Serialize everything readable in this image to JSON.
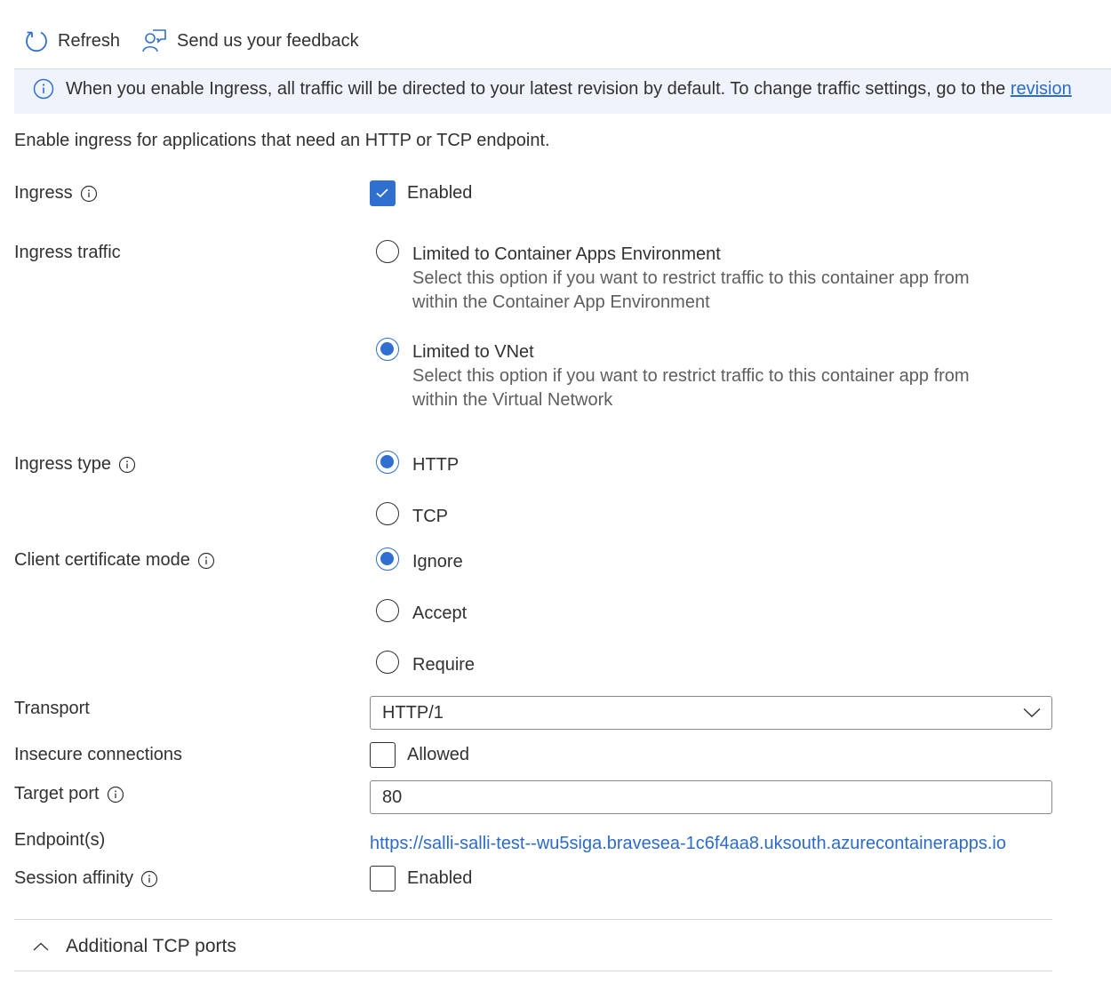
{
  "toolbar": {
    "refresh_label": "Refresh",
    "feedback_label": "Send us your feedback"
  },
  "banner": {
    "text": "When you enable Ingress, all traffic will be directed to your latest revision by default. To change traffic settings, go to the ",
    "link_text": "revision"
  },
  "intro": "Enable ingress for applications that need an HTTP or TCP endpoint.",
  "colors": {
    "accent": "#2f6fd0",
    "link": "#2c6bc9",
    "banner_bg": "#eff4fc"
  },
  "form": {
    "ingress": {
      "label": "Ingress",
      "checkbox_label": "Enabled",
      "checked": true
    },
    "ingress_traffic": {
      "label": "Ingress traffic",
      "options": [
        {
          "label": "Limited to Container Apps Environment",
          "description_line1": "Select this option if you want to restrict traffic to this container app from",
          "description_line2": "within the Container App Environment",
          "selected": false
        },
        {
          "label": "Limited to VNet",
          "description_line1": "Select this option if you want to restrict traffic to this container app from",
          "description_line2": "within the Virtual Network",
          "selected": true
        }
      ]
    },
    "ingress_type": {
      "label": "Ingress type",
      "options": [
        {
          "label": "HTTP",
          "selected": true
        },
        {
          "label": "TCP",
          "selected": false
        }
      ]
    },
    "client_certificate_mode": {
      "label": "Client certificate mode",
      "options": [
        {
          "label": "Ignore",
          "selected": true
        },
        {
          "label": "Accept",
          "selected": false
        },
        {
          "label": "Require",
          "selected": false
        }
      ]
    },
    "transport": {
      "label": "Transport",
      "value": "HTTP/1"
    },
    "insecure_connections": {
      "label": "Insecure connections",
      "checkbox_label": "Allowed",
      "checked": false
    },
    "target_port": {
      "label": "Target port",
      "value": "80"
    },
    "endpoints": {
      "label": "Endpoint(s)",
      "url": "https://salli-salli-test--wu5siga.bravesea-1c6f4aa8.uksouth.azurecontainerapps.io"
    },
    "session_affinity": {
      "label": "Session affinity",
      "checkbox_label": "Enabled",
      "checked": false
    }
  },
  "additional_tcp_ports": {
    "label": "Additional TCP ports",
    "expanded": true
  }
}
